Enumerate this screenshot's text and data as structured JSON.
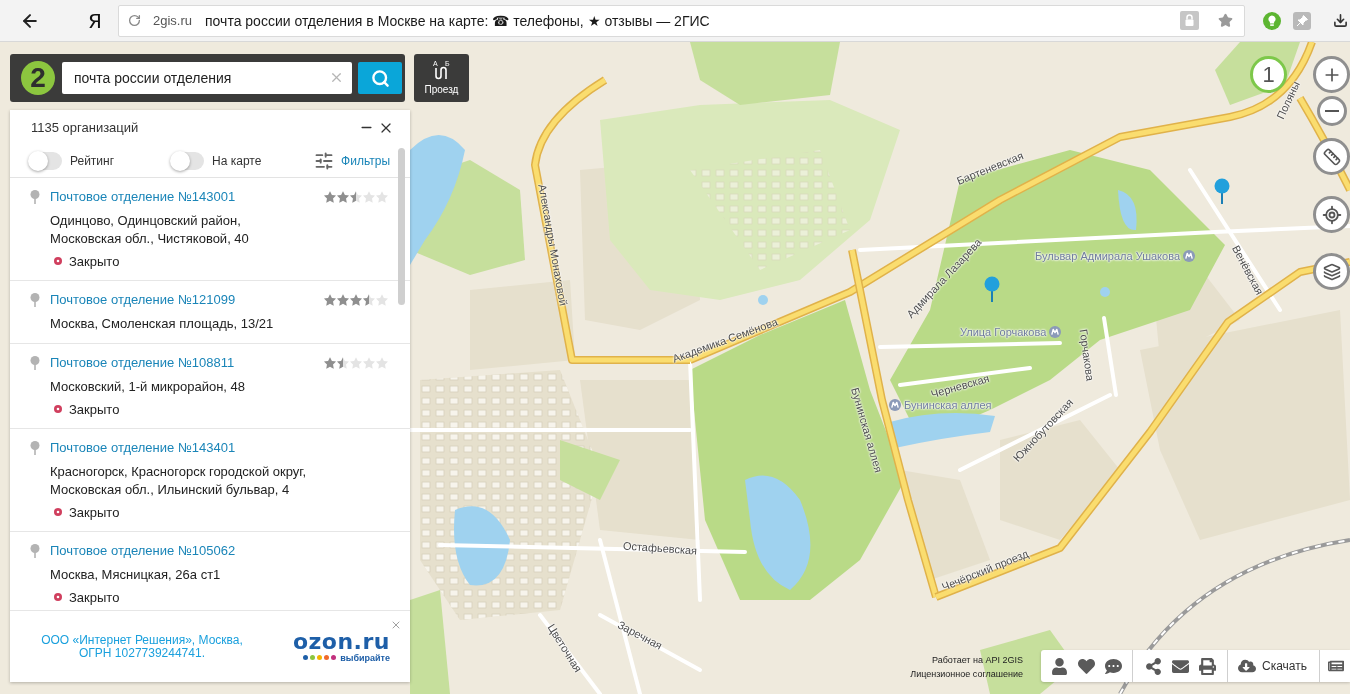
{
  "browser": {
    "logo": "Я",
    "domain": "2gis.ru",
    "title": "почта россии отделения в Москве на карте: ☎ телефоны, ★ отзывы — 2ГИС"
  },
  "search": {
    "logo": "2",
    "value": "почта россии отделения",
    "route": {
      "label": "Проезд",
      "from": "А",
      "to": "Б"
    }
  },
  "results": {
    "count": "1135 организаций",
    "toggles": [
      {
        "label": "Рейтинг",
        "on": false
      },
      {
        "label": "На карте",
        "on": false
      }
    ],
    "filters": "Фильтры",
    "items": [
      {
        "title": "Почтовое отделение №143001",
        "stars": 2.5,
        "address": [
          "Одинцово, Одинцовский район,",
          "Московская обл., Чистяковой, 40"
        ],
        "status": "Закрыто"
      },
      {
        "title": "Почтовое отделение №121099",
        "stars": 3.5,
        "address": [
          "Москва, Смоленская площадь, 13/21"
        ]
      },
      {
        "title": "Почтовое отделение №108811",
        "stars": 1.5,
        "address": [
          "Московский, 1-й микрорайон, 48"
        ],
        "status": "Закрыто"
      },
      {
        "title": "Почтовое отделение №143401",
        "address": [
          "Красногорск, Красногорск городской округ,",
          "Московская обл., Ильинский бульвар, 4"
        ],
        "status": "Закрыто"
      },
      {
        "title": "Почтовое отделение №105062",
        "address": [
          "Москва, Мясницкая, 26а ст1"
        ],
        "status": "Закрыто"
      }
    ]
  },
  "ad": {
    "text": [
      "ООО «Интернет Решения», Москва,",
      "ОГРН 1027739244741."
    ],
    "logo": "ozon.ru",
    "tagline": "выбирайте"
  },
  "map": {
    "cluster": "1",
    "labels": [
      {
        "kind": "street",
        "text": "Александры Монаховой"
      },
      {
        "kind": "street",
        "text": "Бартеневская"
      },
      {
        "kind": "street",
        "text": "Академика Семёнова"
      },
      {
        "kind": "street",
        "text": "Адмирала Лазарева"
      },
      {
        "kind": "metro",
        "text": "Бульвар Адмирала Ушакова"
      },
      {
        "kind": "street",
        "text": "Венёвская"
      },
      {
        "kind": "metro",
        "text": "Улица Горчакова"
      },
      {
        "kind": "street",
        "text": "Горчакова"
      },
      {
        "kind": "street",
        "text": "Черневская"
      },
      {
        "kind": "metro",
        "text": "Бунинская аллея"
      },
      {
        "kind": "street",
        "text": "Бунинская аллея"
      },
      {
        "kind": "street",
        "text": "Южнобутовская"
      },
      {
        "kind": "street",
        "text": "Остафьевская"
      },
      {
        "kind": "street",
        "text": "Чечёрский проезд"
      },
      {
        "kind": "street",
        "text": "Заречная"
      },
      {
        "kind": "street",
        "text": "Цветочная"
      },
      {
        "kind": "street",
        "text": "Поляны"
      }
    ]
  },
  "footer": {
    "credits": "Работает на API 2GIS",
    "license": "Лицензионное соглашение",
    "download": "Скачать"
  }
}
